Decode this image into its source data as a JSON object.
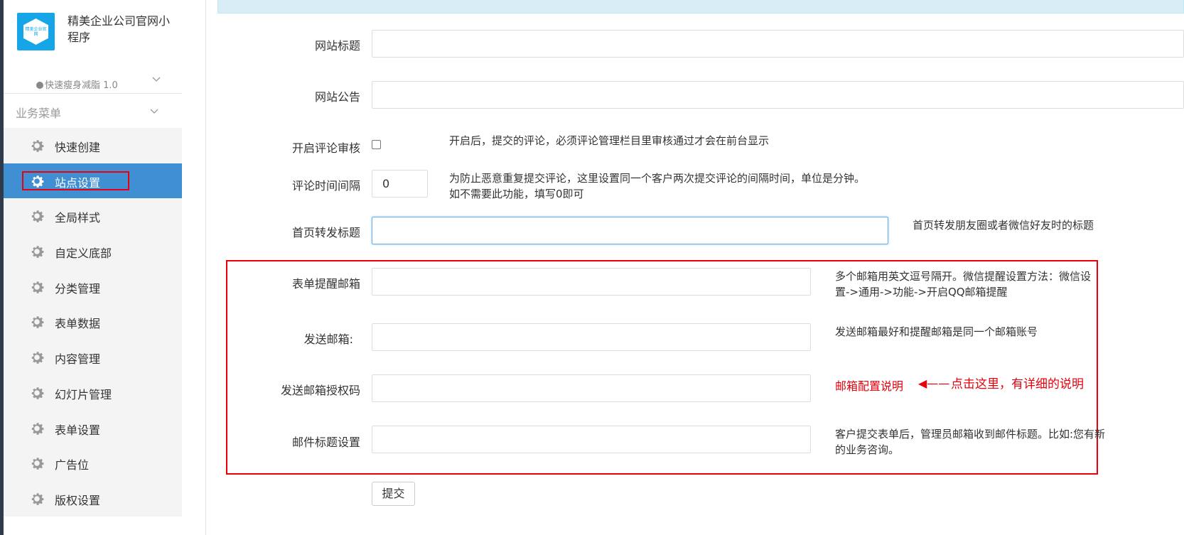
{
  "app": {
    "name": "精美企业公司官网小程序",
    "logo_text": "精美企业官网",
    "version": "快速瘦身减脂 1.0"
  },
  "sidebar": {
    "section_title": "业务菜单",
    "items": [
      {
        "label": "快速创建"
      },
      {
        "label": "站点设置"
      },
      {
        "label": "全局样式"
      },
      {
        "label": "自定义底部"
      },
      {
        "label": "分类管理"
      },
      {
        "label": "表单数据"
      },
      {
        "label": "内容管理"
      },
      {
        "label": "幻灯片管理"
      },
      {
        "label": "表单设置"
      },
      {
        "label": "广告位"
      },
      {
        "label": "版权设置"
      }
    ]
  },
  "form": {
    "site_title": {
      "label": "网站标题",
      "value": ""
    },
    "site_notice": {
      "label": "网站公告",
      "value": ""
    },
    "comment_review": {
      "label": "开启评论审核",
      "checked": false,
      "help": "开启后，提交的评论，必须评论管理栏目里审核通过才会在前台显示"
    },
    "comment_interval": {
      "label": "评论时间间隔",
      "value": "0",
      "help_line1": "为防止恶意重复提交评论，这里设置同一个客户两次提交评论的间隔时间，单位是分钟。",
      "help_line2": "如不需要此功能，填写0即可"
    },
    "share_title": {
      "label": "首页转发标题",
      "value": "",
      "help": "首页转发朋友圈或者微信好友时的标题"
    },
    "notify_email": {
      "label": "表单提醒邮箱",
      "value": "",
      "help_line1": "多个邮箱用英文逗号隔开。微信提醒设置方法：微信设",
      "help_line2": "置->通用->功能->开启QQ邮箱提醒"
    },
    "send_email": {
      "label": "发送邮箱:",
      "value": "",
      "help": "发送邮箱最好和提醒邮箱是同一个邮箱账号"
    },
    "auth_code": {
      "label": "发送邮箱授权码",
      "value": "",
      "link": "邮箱配置说明",
      "arrow": "◀——",
      "annotation": "点击这里，有详细的说明"
    },
    "mail_subject": {
      "label": "邮件标题设置",
      "value": "",
      "help_line1": "客户提交表单后，管理员邮箱收到邮件标题。比如:您有新",
      "help_line2": "的业务咨询。"
    },
    "submit_label": "提交"
  },
  "colors": {
    "accent": "#3f8fd2",
    "annotation": "#e8000b",
    "brand": "#16a6e8"
  }
}
